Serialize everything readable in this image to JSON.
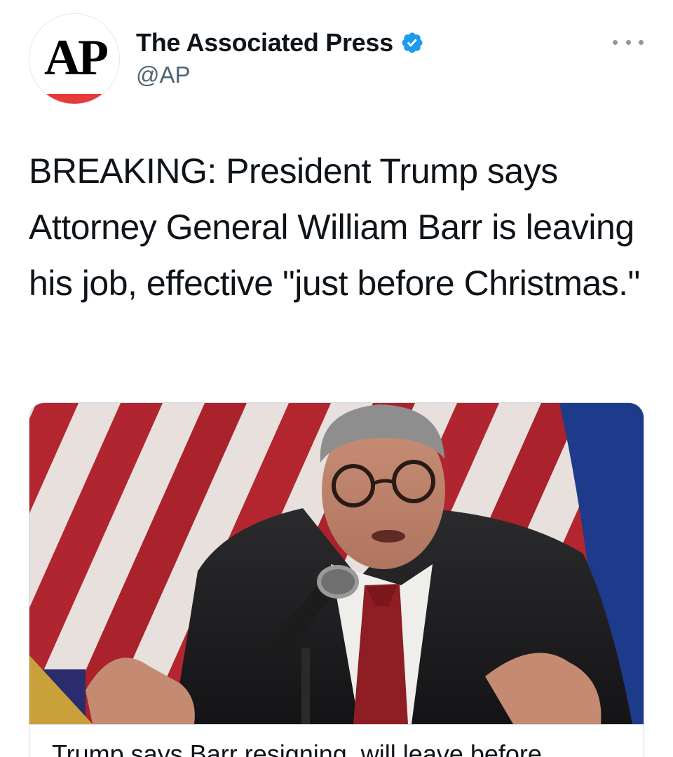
{
  "author": {
    "avatar_text": "AP",
    "display_name": "The Associated Press",
    "handle": "@AP",
    "verified": true,
    "verified_icon": "verified-badge-icon",
    "accent_color": "#1d9bf0",
    "avatar_stripe_color": "#e53b3b"
  },
  "tweet": {
    "text": "BREAKING: President Trump says Attorney General William Barr is leaving his job, effective \"just before Christmas.\"",
    "more_icon": "more-options-icon"
  },
  "link_card": {
    "image_alt": "news-photo",
    "title": "Trump says Barr resigning, will leave before"
  }
}
